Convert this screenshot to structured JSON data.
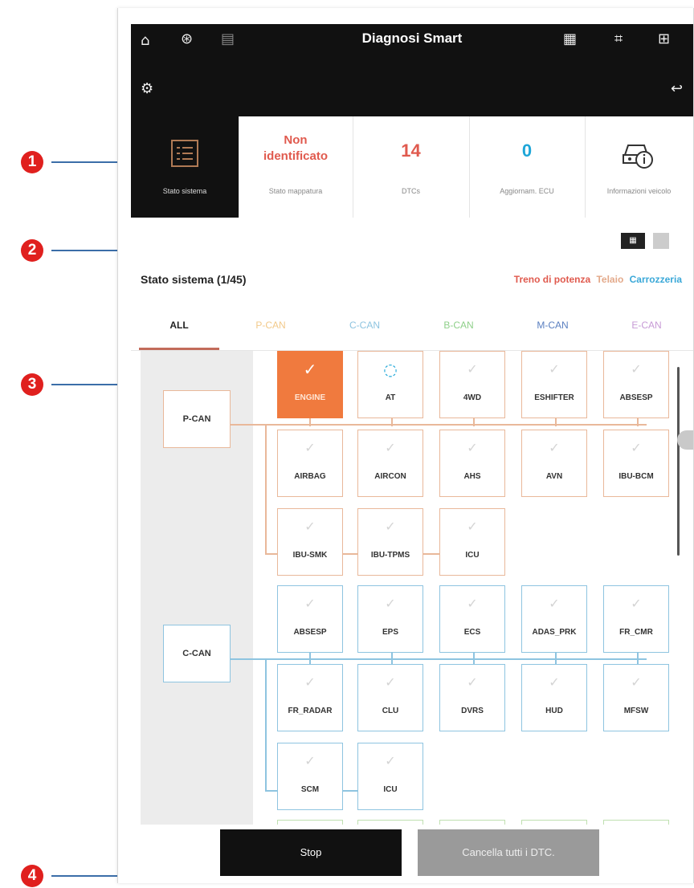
{
  "topbar": {
    "title": "Diagnosi Smart",
    "icons": [
      "home-icon",
      "network-icon",
      "document-icon",
      "vehicle-info-icon",
      "focus-icon",
      "grid-icon",
      "car-settings-icon",
      "back-icon"
    ]
  },
  "summary": {
    "stato_sistema_label": "Stato sistema",
    "mappatura_value": "Non identificato",
    "mappatura_label": "Stato mappatura",
    "dtc_value": "14",
    "dtc_label": "DTCs",
    "ecu_value": "0",
    "ecu_label": "Aggiornam. ECU",
    "vehicle_label": "Informazioni veicolo"
  },
  "section": {
    "title": "Stato sistema (1/45)",
    "legend": {
      "power": "Treno di potenza",
      "chassis": "Telaio",
      "body": "Carrozzeria"
    }
  },
  "tabs": [
    "ALL",
    "P-CAN",
    "C-CAN",
    "B-CAN",
    "M-CAN",
    "E-CAN"
  ],
  "buses": {
    "p": "P-CAN",
    "c": "C-CAN"
  },
  "pcan_ecus": [
    "ENGINE",
    "AT",
    "4WD",
    "ESHIFTER",
    "ABSESP",
    "AIRBAG",
    "AIRCON",
    "AHS",
    "AVN",
    "IBU-BCM",
    "IBU-SMK",
    "IBU-TPMS",
    "ICU"
  ],
  "ccan_ecus": [
    "ABSESP",
    "EPS",
    "ECS",
    "ADAS_PRK",
    "FR_CMR",
    "FR_RADAR",
    "CLU",
    "DVRS",
    "HUD",
    "MFSW",
    "SCM",
    "ICU"
  ],
  "buttons": {
    "stop": "Stop",
    "clear": "Cancella tutti i DTC."
  },
  "markers": [
    "1",
    "2",
    "3",
    "4"
  ],
  "colors": {
    "accent": "#f07a3e",
    "power": "#e05a4e",
    "chassis": "#e3a98a",
    "body": "#3aa8d8"
  }
}
